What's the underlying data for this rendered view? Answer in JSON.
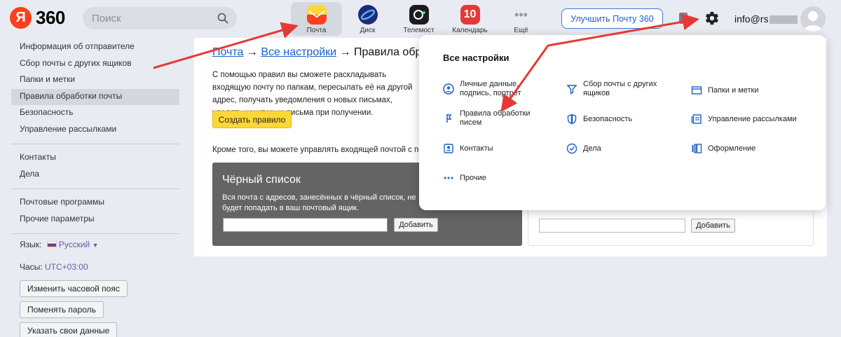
{
  "header": {
    "logo_letter": "Я",
    "logo_text": "360",
    "search_placeholder": "Поиск",
    "services": [
      {
        "label": "Почта"
      },
      {
        "label": "Диск"
      },
      {
        "label": "Телемост"
      },
      {
        "label": "Календарь",
        "badge": "10"
      },
      {
        "label": "Ещё"
      }
    ],
    "upgrade_label": "Улучшить Почту 360",
    "account": "info@rs"
  },
  "sidebar": {
    "group1": [
      {
        "label": "Информация об отправителе"
      },
      {
        "label": "Сбор почты с других ящиков"
      },
      {
        "label": "Папки и метки"
      },
      {
        "label": "Правила обработки почты",
        "active": true
      },
      {
        "label": "Безопасность"
      },
      {
        "label": "Управление рассылками"
      }
    ],
    "group2": [
      {
        "label": "Контакты"
      },
      {
        "label": "Дела"
      }
    ],
    "group3": [
      {
        "label": "Почтовые программы"
      },
      {
        "label": "Прочие параметры"
      }
    ],
    "lang_label": "Язык:",
    "lang_value": "Русский",
    "tz_label": "Часы:",
    "tz_value": "UTC+03:00",
    "buttons": [
      "Изменить часовой пояс",
      "Поменять пароль",
      "Указать свои данные"
    ]
  },
  "main": {
    "crumb_mail": "Почта",
    "crumb_arrow": "→",
    "crumb_settings": "Все настройки",
    "crumb_current": "Правила обра",
    "description": "С помощью правил вы сможете раскладывать входящую почту по папкам, пересылать её на другой адрес, получать уведомления о новых письмах, удалять некоторые письма при получении.",
    "create_rule": "Создать правило",
    "also_text": "Кроме того, вы можете управлять входящей почтой с по",
    "blacklist_title": "Чёрный список",
    "blacklist_desc": "Вся почта с адресов, занесённых в чёрный список, не будет попадать в ваш почтовый ящик.",
    "add_label": "Добавить"
  },
  "popup": {
    "title": "Все настройки",
    "items": [
      {
        "label": "Личные данные, подпись, портрет",
        "icon": "user-circle-icon"
      },
      {
        "label": "Сбор почты с других ящиков",
        "icon": "funnel-icon"
      },
      {
        "label": "Папки и метки",
        "icon": "folder-icon"
      },
      {
        "label": "Правила обработки писем",
        "icon": "rules-icon"
      },
      {
        "label": "Безопасность",
        "icon": "shield-icon"
      },
      {
        "label": "Управление рассылками",
        "icon": "newsletter-icon"
      },
      {
        "label": "Контакты",
        "icon": "contacts-icon"
      },
      {
        "label": "Дела",
        "icon": "check-circle-icon"
      },
      {
        "label": "Оформление",
        "icon": "theme-icon"
      },
      {
        "label": "Прочие",
        "icon": "more-dots-icon"
      }
    ]
  },
  "colors": {
    "accent_red": "#e53935",
    "brand_yellow": "#fdd835",
    "link_blue": "#1a5fc9"
  }
}
